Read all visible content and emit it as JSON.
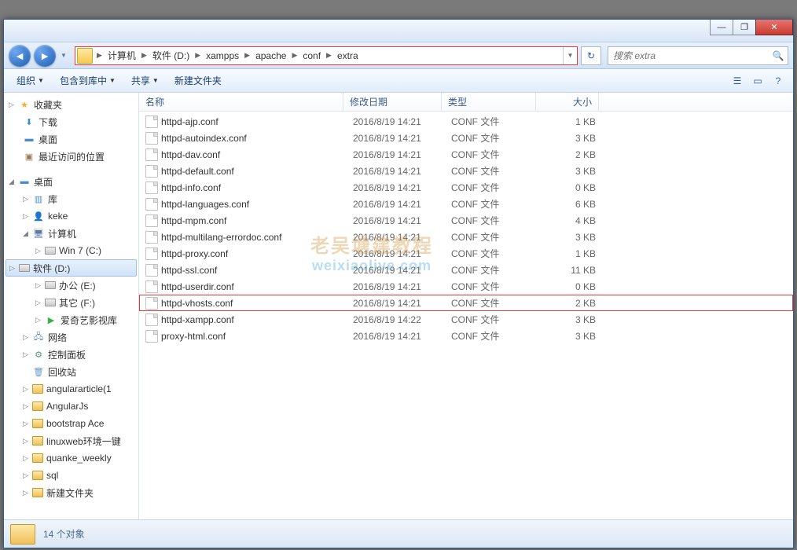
{
  "titlebar": {
    "min": "—",
    "max": "❐",
    "close": "✕"
  },
  "breadcrumb": {
    "segs": [
      "计算机",
      "软件 (D:)",
      "xampps",
      "apache",
      "conf",
      "extra"
    ]
  },
  "search": {
    "placeholder": "搜索 extra"
  },
  "toolbar": {
    "org": "组织",
    "include": "包含到库中",
    "share": "共享",
    "newfolder": "新建文件夹"
  },
  "columns": {
    "name": "名称",
    "date": "修改日期",
    "type": "类型",
    "size": "大小"
  },
  "sidebar": {
    "fav": "收藏夹",
    "downloads": "下载",
    "desktop": "桌面",
    "recent": "最近访问的位置",
    "desktop2": "桌面",
    "library": "库",
    "keke": "keke",
    "computer": "计算机",
    "win7c": "Win 7 (C:)",
    "softd": "软件 (D:)",
    "officee": "办公 (E:)",
    "otherf": "其它 (F:)",
    "iqiyi": "爱奇艺影视库",
    "network": "网络",
    "control": "控制面板",
    "recycle": "回收站",
    "angulararticle": "angulararticle(1",
    "angularjs": "AngularJs",
    "bootstrapace": "bootstrap Ace",
    "linuxweb": "linuxweb环境一键",
    "quanke": "quanke_weekly",
    "sql": "sql",
    "newfolder2": "新建文件夹"
  },
  "files": [
    {
      "name": "httpd-ajp.conf",
      "date": "2016/8/19 14:21",
      "type": "CONF 文件",
      "size": "1 KB",
      "hl": false
    },
    {
      "name": "httpd-autoindex.conf",
      "date": "2016/8/19 14:21",
      "type": "CONF 文件",
      "size": "3 KB",
      "hl": false
    },
    {
      "name": "httpd-dav.conf",
      "date": "2016/8/19 14:21",
      "type": "CONF 文件",
      "size": "2 KB",
      "hl": false
    },
    {
      "name": "httpd-default.conf",
      "date": "2016/8/19 14:21",
      "type": "CONF 文件",
      "size": "3 KB",
      "hl": false
    },
    {
      "name": "httpd-info.conf",
      "date": "2016/8/19 14:21",
      "type": "CONF 文件",
      "size": "0 KB",
      "hl": false
    },
    {
      "name": "httpd-languages.conf",
      "date": "2016/8/19 14:21",
      "type": "CONF 文件",
      "size": "6 KB",
      "hl": false
    },
    {
      "name": "httpd-mpm.conf",
      "date": "2016/8/19 14:21",
      "type": "CONF 文件",
      "size": "4 KB",
      "hl": false
    },
    {
      "name": "httpd-multilang-errordoc.conf",
      "date": "2016/8/19 14:21",
      "type": "CONF 文件",
      "size": "3 KB",
      "hl": false
    },
    {
      "name": "httpd-proxy.conf",
      "date": "2016/8/19 14:21",
      "type": "CONF 文件",
      "size": "1 KB",
      "hl": false
    },
    {
      "name": "httpd-ssl.conf",
      "date": "2016/8/19 14:21",
      "type": "CONF 文件",
      "size": "11 KB",
      "hl": false
    },
    {
      "name": "httpd-userdir.conf",
      "date": "2016/8/19 14:21",
      "type": "CONF 文件",
      "size": "0 KB",
      "hl": false
    },
    {
      "name": "httpd-vhosts.conf",
      "date": "2016/8/19 14:21",
      "type": "CONF 文件",
      "size": "2 KB",
      "hl": true
    },
    {
      "name": "httpd-xampp.conf",
      "date": "2016/8/19 14:22",
      "type": "CONF 文件",
      "size": "3 KB",
      "hl": false
    },
    {
      "name": "proxy-html.conf",
      "date": "2016/8/19 14:21",
      "type": "CONF 文件",
      "size": "3 KB",
      "hl": false
    }
  ],
  "status": {
    "count": "14 个对象"
  },
  "watermark": {
    "top": "老吴塘建教程",
    "bottom": "weixiaolive.com"
  }
}
